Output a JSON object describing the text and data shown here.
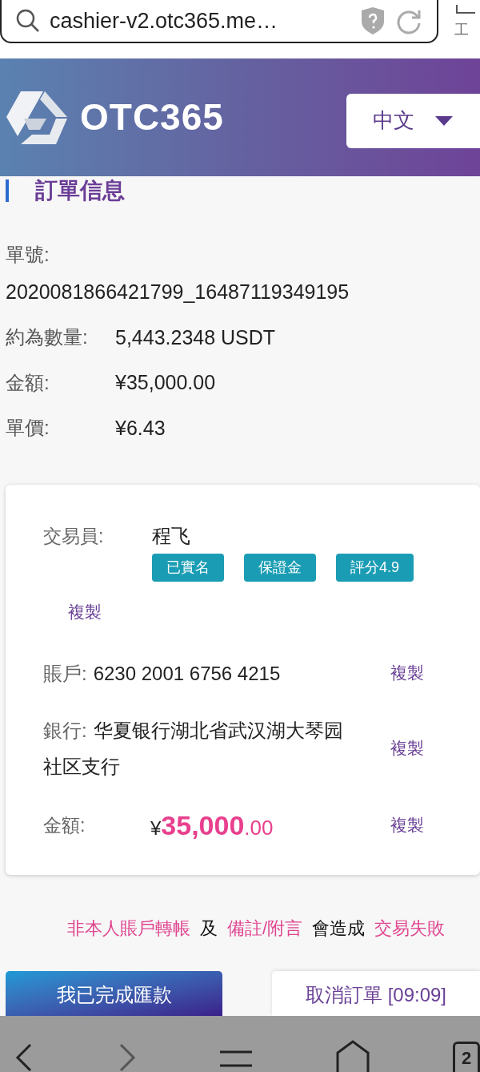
{
  "browser": {
    "url": "cashier-v2.otc365.me…",
    "tools_label": "工",
    "tab_count": "2"
  },
  "header": {
    "logo": "OTC365",
    "language": "中文"
  },
  "order": {
    "title": "訂單信息",
    "fields": [
      {
        "label": "單號:",
        "value": "2020081866421799_16487119349195",
        "kind": "stacked"
      },
      {
        "label": "約為數量:",
        "value": "5,443.2348 USDT",
        "kind": "inline"
      },
      {
        "label": "金額:",
        "value": "¥35,000.00",
        "kind": "inline"
      },
      {
        "label": "單價:",
        "value": "¥6.43",
        "kind": "inline"
      }
    ]
  },
  "trader": {
    "label": "交易員:",
    "name": "程飞",
    "badges": [
      "已實名",
      "保證金",
      "評分4.9"
    ],
    "copy_label": "複製"
  },
  "payment": {
    "rows": [
      {
        "label": "賬戶:",
        "value": "6230 2001 6756 4215",
        "copy_label": "複製"
      },
      {
        "label": "銀行:",
        "value": "华夏银行湖北省武汉湖大琴园社区支行",
        "copy_label": "複製"
      }
    ],
    "amount": {
      "label": "金額:",
      "currency": "¥",
      "integer": "35,000",
      "decimals": ".00",
      "copy_label": "複製"
    }
  },
  "warning": [
    {
      "text": "非本人賬戶轉帳",
      "highlight": true
    },
    {
      "text": "及",
      "highlight": false
    },
    {
      "text": "備註/附言",
      "highlight": true
    },
    {
      "text": "會造成",
      "highlight": false
    },
    {
      "text": "交易失敗",
      "highlight": true
    }
  ],
  "buttons": {
    "confirm": "我已完成匯款",
    "cancel": "取消訂單 [09:09]"
  }
}
